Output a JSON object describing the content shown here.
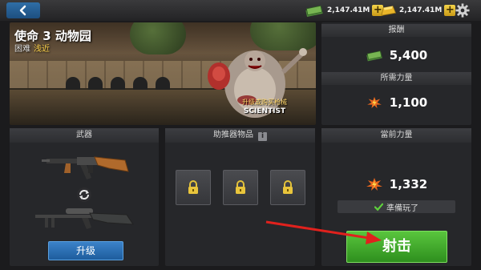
{
  "topbar": {
    "back_icon": "back-arrow-icon",
    "currency_cash": "2,147.41M",
    "currency_gold": "2,147.41M",
    "add_label": "+",
    "settings_icon": "gear-icon"
  },
  "mission": {
    "title": "使命 3  动物园",
    "difficulty_label": "困难",
    "difficulty_value": "浅近",
    "upgrade_note": "升级或购买枪械",
    "boss_name": "SCIENTIST"
  },
  "reward": {
    "reward_header": "报酬",
    "reward_value": "5,400",
    "required_header": "所需力量",
    "required_value": "1,100"
  },
  "weapons": {
    "header": "武器",
    "upgrade_label": "升级",
    "primary_weapon": "assault-rifle",
    "secondary_weapon": "sniper-rifle"
  },
  "boosters": {
    "header": "助推器物品",
    "info_label": "i",
    "slots": [
      "locked",
      "locked",
      "locked"
    ]
  },
  "current": {
    "header": "當前力量",
    "power_value": "1,332",
    "ready_label": "準備玩了",
    "fire_label": "射击"
  },
  "colors": {
    "accent_green": "#3aa52a",
    "accent_blue": "#2a6fb0",
    "gold": "#f3c93a",
    "annotation_red": "#e0211d"
  }
}
